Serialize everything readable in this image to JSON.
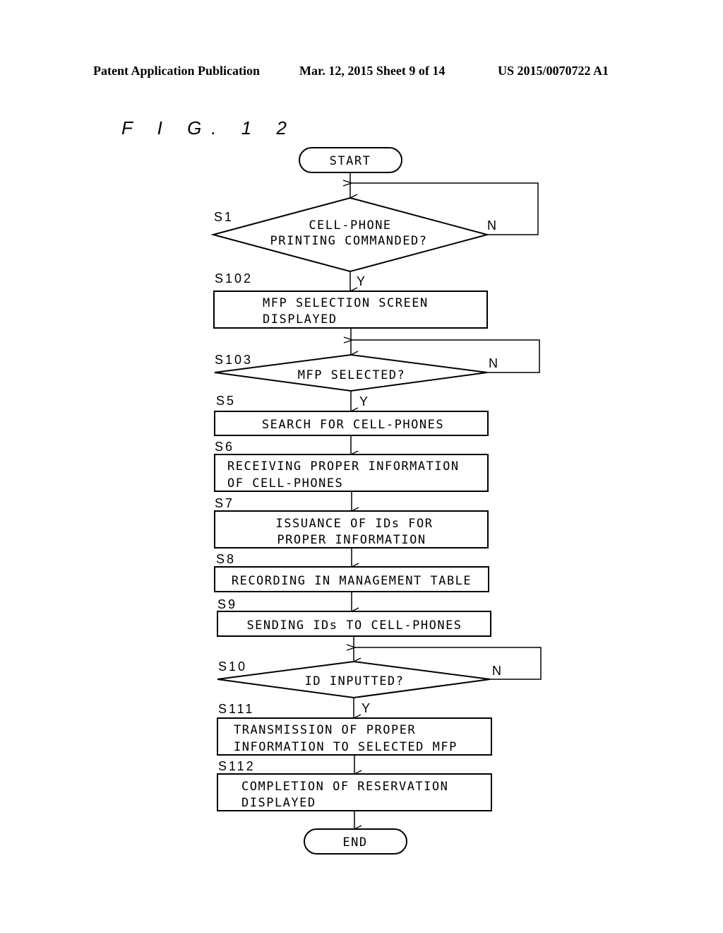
{
  "header": {
    "left": "Patent Application Publication",
    "center": "Mar. 12, 2015  Sheet 9 of 14",
    "right": "US 2015/0070722 A1"
  },
  "figure_label": "F I G. 1 2",
  "flowchart": {
    "start": "START",
    "end": "END",
    "yes_label": "Y",
    "no_label": "N",
    "steps": {
      "s1": {
        "id": "S1",
        "type": "decision",
        "lines": [
          "CELL-PHONE",
          "PRINTING COMMANDED?"
        ]
      },
      "s102": {
        "id": "S102",
        "type": "process",
        "lines": [
          "MFP SELECTION SCREEN",
          "DISPLAYED"
        ]
      },
      "s103": {
        "id": "S103",
        "type": "decision",
        "lines": [
          "MFP SELECTED?"
        ]
      },
      "s5": {
        "id": "S5",
        "type": "process",
        "lines": [
          "SEARCH FOR CELL-PHONES"
        ]
      },
      "s6": {
        "id": "S6",
        "type": "process",
        "lines": [
          "RECEIVING PROPER INFORMATION",
          "OF CELL-PHONES"
        ]
      },
      "s7": {
        "id": "S7",
        "type": "process",
        "lines": [
          "ISSUANCE OF IDs FOR",
          "PROPER INFORMATION"
        ]
      },
      "s8": {
        "id": "S8",
        "type": "process",
        "lines": [
          "RECORDING IN MANAGEMENT TABLE"
        ]
      },
      "s9": {
        "id": "S9",
        "type": "process",
        "lines": [
          "SENDING IDs TO CELL-PHONES"
        ]
      },
      "s10": {
        "id": "S10",
        "type": "decision",
        "lines": [
          "ID INPUTTED?"
        ]
      },
      "s111": {
        "id": "S111",
        "type": "process",
        "lines": [
          "TRANSMISSION OF PROPER",
          "INFORMATION TO SELECTED MFP"
        ]
      },
      "s112": {
        "id": "S112",
        "type": "process",
        "lines": [
          "COMPLETION OF RESERVATION",
          "DISPLAYED"
        ]
      }
    }
  }
}
